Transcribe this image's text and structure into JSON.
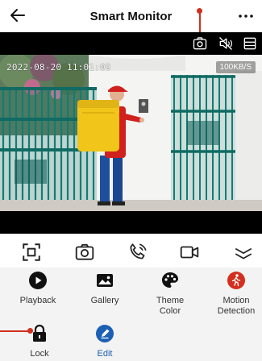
{
  "header": {
    "title": "Smart Monitor"
  },
  "video": {
    "timestamp": "2022-08-20 11:01:09",
    "bitrate": "100KB/S"
  },
  "features": [
    {
      "label": "Playback",
      "icon": "play-icon"
    },
    {
      "label": "Gallery",
      "icon": "gallery-icon"
    },
    {
      "label": "Theme Color",
      "icon": "palette-icon"
    },
    {
      "label": "Motion Detection",
      "icon": "motion-detection-icon"
    },
    {
      "label": "Lock",
      "icon": "lock-icon"
    },
    {
      "label": "Edit",
      "icon": "edit-icon"
    }
  ],
  "colors": {
    "accent_blue": "#1d5fb3",
    "alert_red": "#d32f1e",
    "marker_red": "#c42b1c"
  }
}
